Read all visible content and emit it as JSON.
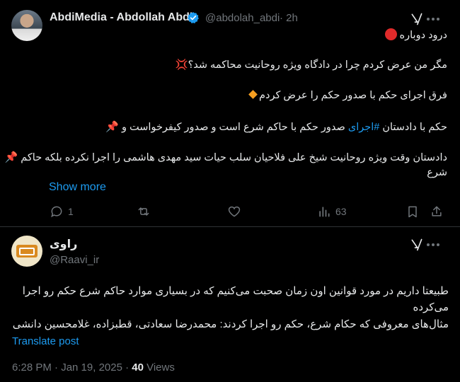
{
  "tweet1": {
    "display_name": "AbdiMedia - Abdollah Abdi",
    "handle": "@abdolah_abdi",
    "time": "· 2h",
    "lines": [
      {
        "marker": "red-circle",
        "text": "درود دوباره"
      },
      {
        "marker": "anger-emoji",
        "text": "مگر من عرض کردم چرا در دادگاه ویژه روحانیت محاکمه شد؟"
      },
      {
        "marker": "orange-diamond",
        "text": "فرق اجرای حکم با صدور حکم را عرض کردم"
      },
      {
        "marker": "pushpin",
        "text_before": "صدور حکم با حاکم شرع است و صدور کیفرخواست و",
        "hashtag": "#اجرای",
        "text_after": "حکم با دادستان"
      },
      {
        "marker": "pushpin",
        "text": "دادستان وقت ویژه روحانیت شیخ علی فلاحیان سلب حیات سید مهدی هاشمی را اجرا نکرده بلکه حاکم",
        "text_cont": "شرع"
      }
    ],
    "show_more": "Show more",
    "actions": {
      "replies": "1",
      "retweets": "",
      "likes": "",
      "views": "63"
    }
  },
  "tweet2": {
    "display_name": "راوی",
    "handle": "@Raavi_ir",
    "lines": [
      "طبیعتا داریم در مورد قوانین اون زمان صحبت می‌کنیم که در بسیاری موارد حاکم شرع حکم رو اجرا",
      "می‌کرده",
      "مثال‌های معروفی که حکام شرع، حکم رو اجرا کردند: محمدرضا سعادتی، قطبزاده، غلامحسین دانشی"
    ],
    "translate": "Translate post",
    "timestamp": "6:28 PM · Jan 19, 2025 · ",
    "views_count": "40",
    "views_label": " Views"
  },
  "icons": [
    "verified-badge-icon",
    "grok-icon",
    "more-icon",
    "reply-icon",
    "retweet-icon",
    "like-icon",
    "views-icon",
    "bookmark-icon",
    "share-icon"
  ],
  "colors": {
    "background": "#000000",
    "text": "#e7e9ea",
    "muted": "#71767b",
    "link": "#1d9bf0",
    "verified": "#1d9bf0",
    "divider": "#2f3336"
  }
}
